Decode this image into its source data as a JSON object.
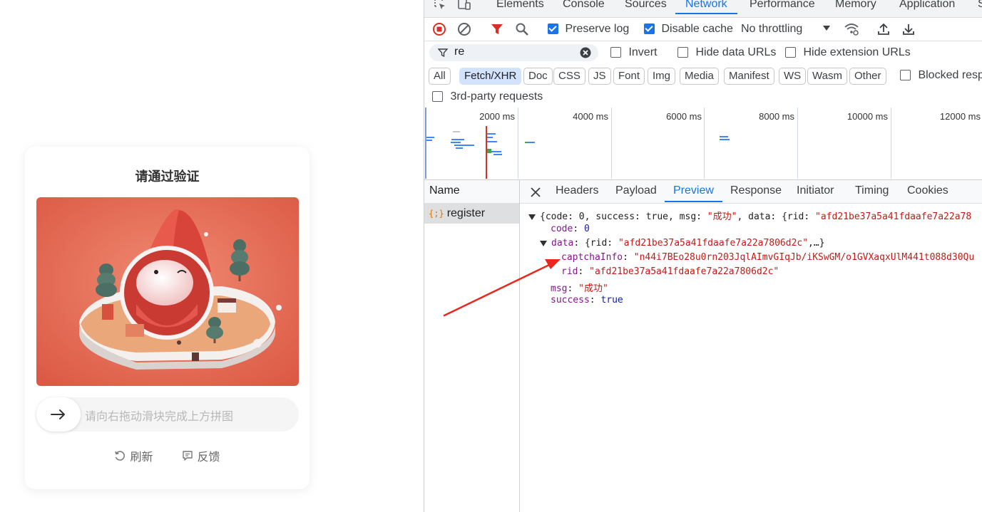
{
  "captcha": {
    "title": "请通过验证",
    "slider_hint": "请向右拖动滑块完成上方拼图",
    "refresh_label": "刷新",
    "feedback_label": "反馈"
  },
  "devtools": {
    "main_tabs": [
      "Elements",
      "Console",
      "Sources",
      "Network",
      "Performance",
      "Memory",
      "Application",
      "S"
    ],
    "active_tab": "Network",
    "toolbar": {
      "preserve_log": "Preserve log",
      "disable_cache": "Disable cache",
      "throttling": "No throttling"
    },
    "filter": {
      "value": "re",
      "invert": "Invert",
      "hide_data_urls": "Hide data URLs",
      "hide_extension_urls": "Hide extension URLs"
    },
    "types": [
      "All",
      "Fetch/XHR",
      "Doc",
      "CSS",
      "JS",
      "Font",
      "Img",
      "Media",
      "Manifest",
      "WS",
      "Wasm",
      "Other"
    ],
    "active_type": "Fetch/XHR",
    "blocked_requests": "Blocked respo",
    "third_party": "3rd-party requests",
    "overview_ticks": [
      "2000 ms",
      "4000 ms",
      "6000 ms",
      "8000 ms",
      "10000 ms",
      "12000 ms"
    ],
    "name_header": "Name",
    "request_name": "register",
    "request_icon": "{;}",
    "detail_tabs": [
      "Headers",
      "Payload",
      "Preview",
      "Response",
      "Initiator",
      "Timing",
      "Cookies"
    ],
    "active_detail_tab": "Preview",
    "preview": {
      "summary_open": "{code: 0, success: true, msg: ",
      "summary_msg": "\"成功\"",
      "summary_rest": ", data: {rid: ",
      "summary_rid": "\"afd21be37a5a41fdaafe7a22a78",
      "code_key": "code",
      "code_value": "0",
      "data_key": "data",
      "data_summary_open": "{rid: ",
      "data_summary_rid": "\"afd21be37a5a41fdaafe7a22a7806d2c\"",
      "data_summary_close": ",…}",
      "captcha_key": "captchaInfo",
      "captcha_value": "\"n44i7BEo28u0rn203JqlAImvGIqJb/iKSwGM/o1GVXaqxUlM441t088d30Qu",
      "rid_key": "rid",
      "rid_value": "\"afd21be37a5a41fdaafe7a22a7806d2c\"",
      "msg_key": "msg",
      "msg_value": "\"成功\"",
      "success_key": "success",
      "success_value": "true"
    }
  },
  "colors": {
    "accent": "#1a73e8",
    "record_red": "#d93025",
    "annotation_arrow": "#e8281f",
    "puzzle_background": "#e8705a"
  }
}
